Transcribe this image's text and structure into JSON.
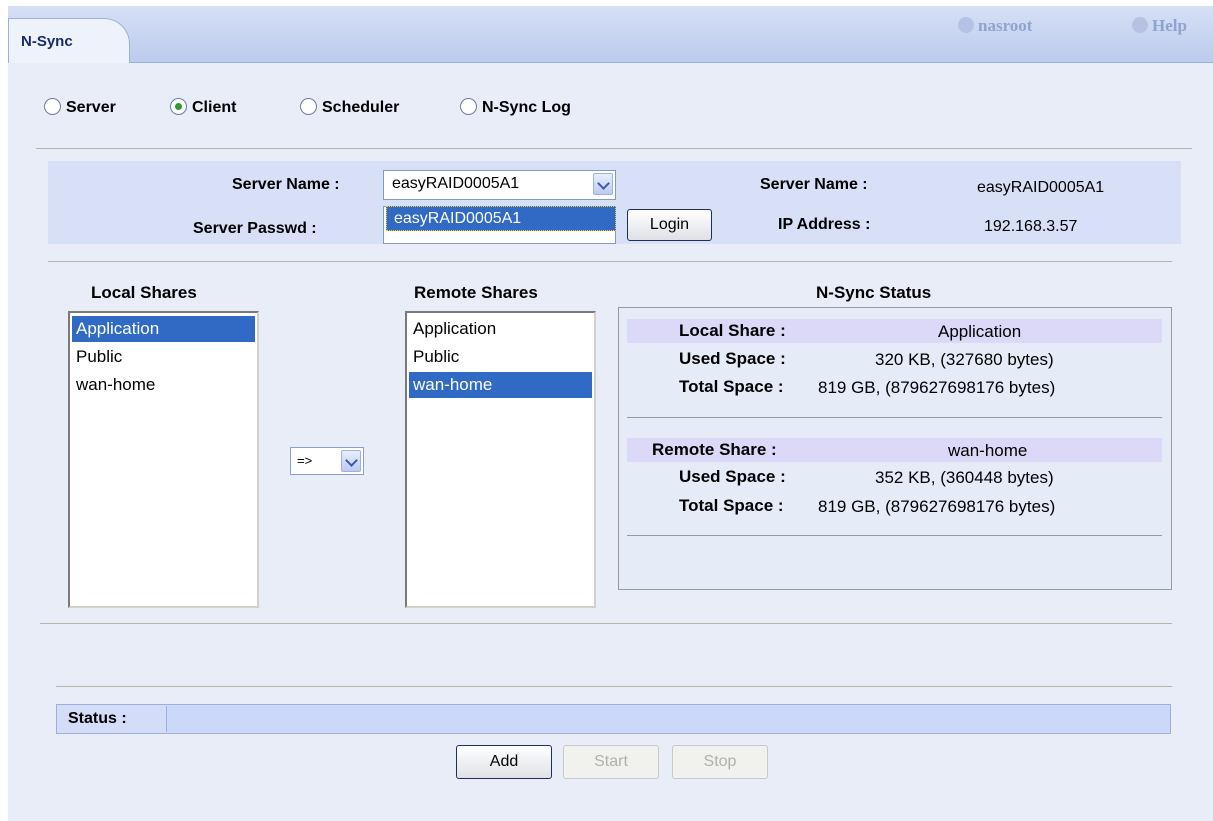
{
  "header": {
    "tab_label": "N-Sync",
    "user": "nasroot",
    "help": "Help"
  },
  "modes": [
    {
      "label": "Server",
      "checked": false
    },
    {
      "label": "Client",
      "checked": true
    },
    {
      "label": "Scheduler",
      "checked": false
    },
    {
      "label": "N-Sync Log",
      "checked": false
    }
  ],
  "connection": {
    "server_name_label": "Server Name :",
    "server_name_value": "easyRAID0005A1",
    "server_name_dropdown_item": "easyRAID0005A1",
    "server_passwd_label": "Server Passwd :",
    "login_button": "Login",
    "info_server_name_label": "Server Name :",
    "info_server_name_value": "easyRAID0005A1",
    "info_ip_label": "IP Address :",
    "info_ip_value": "192.168.3.57"
  },
  "local_shares": {
    "title": "Local Shares",
    "items": [
      "Application",
      "Public",
      "wan-home"
    ],
    "selected": "Application"
  },
  "direction_select": "=>",
  "remote_shares": {
    "title": "Remote Shares",
    "items": [
      "Application",
      "Public",
      "wan-home"
    ],
    "selected": "wan-home"
  },
  "nsync_status": {
    "title": "N-Sync Status",
    "local": {
      "share_label": "Local Share :",
      "share_value": "Application",
      "used_label": "Used Space :",
      "used_value": "320 KB, (327680 bytes)",
      "total_label": "Total Space :",
      "total_value": "819 GB, (879627698176 bytes)"
    },
    "remote": {
      "share_label": "Remote Share :",
      "share_value": "wan-home",
      "used_label": "Used Space :",
      "used_value": "352 KB, (360448 bytes)",
      "total_label": "Total Space :",
      "total_value": "819 GB, (879627698176 bytes)"
    }
  },
  "status": {
    "label": "Status :",
    "value": ""
  },
  "actions": {
    "add": "Add",
    "start": "Start",
    "stop": "Stop"
  },
  "colors": {
    "selection": "#316ac5",
    "panel": "#d7e0f7",
    "background": "#e8edf8"
  }
}
